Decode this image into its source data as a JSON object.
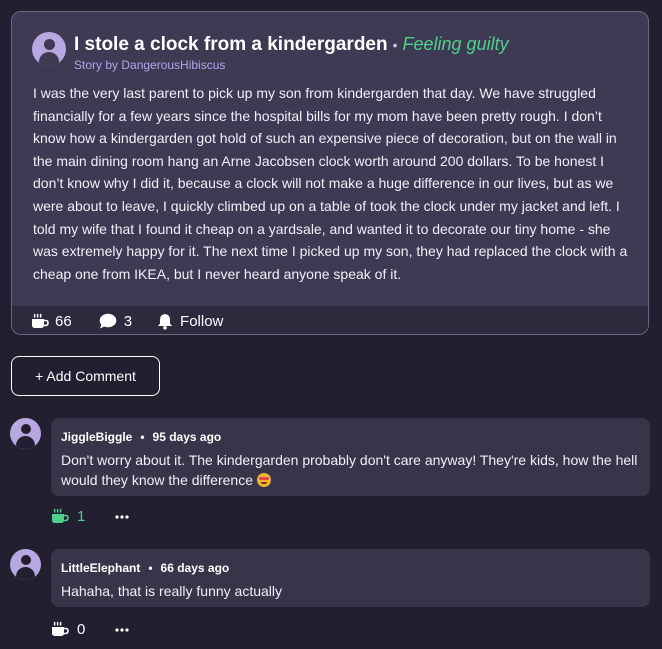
{
  "post": {
    "title": "I stole a clock from a kindergarden",
    "separator": "•",
    "feeling": "Feeling guilty",
    "author": "Story by DangerousHibiscus",
    "body": "I was the very last parent to pick up my son from kindergarden that day. We have struggled financially for a few years since the hospital bills for my mom have been pretty rough. I don’t know how a kindergarden got hold of such an expensive piece of decoration, but on the wall in the main dining room hang an Arne Jacobsen clock worth around 200 dollars. To be honest I don’t know why I did it, because a clock will not make a huge difference in our lives, but as we were about to leave, I quickly climbed up on a table of took the clock under my jacket and left. I told my wife that I found it cheap on a yardsale, and wanted it to decorate our tiny home - she was extremely happy for it. The next time I picked up my son, they had replaced the clock with a cheap one from IKEA, but I never heard anyone speak of it.",
    "likes": "66",
    "comments": "3",
    "follow_label": "Follow"
  },
  "add_comment_label": "+ Add Comment",
  "comments": [
    {
      "username": "JiggleBiggle",
      "separator": "•",
      "time": "95 days ago",
      "text": "Don't worry about it. The kindergarden probably don't care anyway! They're kids, how the hell would they know the difference",
      "emoji": "grimacing-face-emoji",
      "likes": "1",
      "liked": true
    },
    {
      "username": "LittleElephant",
      "separator": "•",
      "time": "66 days ago",
      "text": "Hahaha, that is really funny actually",
      "likes": "0",
      "liked": false
    }
  ],
  "colors": {
    "background": "#221f30",
    "card": "#3e3a53",
    "accent_green": "#4fd08c",
    "author_purple": "#b7a4ef",
    "avatar": "#b8a8e2"
  },
  "icons": {
    "like": "coffee-cup-icon",
    "comment": "speech-bubble-icon",
    "follow": "bell-icon",
    "more": "ellipsis-icon",
    "avatar": "user-avatar-icon"
  }
}
